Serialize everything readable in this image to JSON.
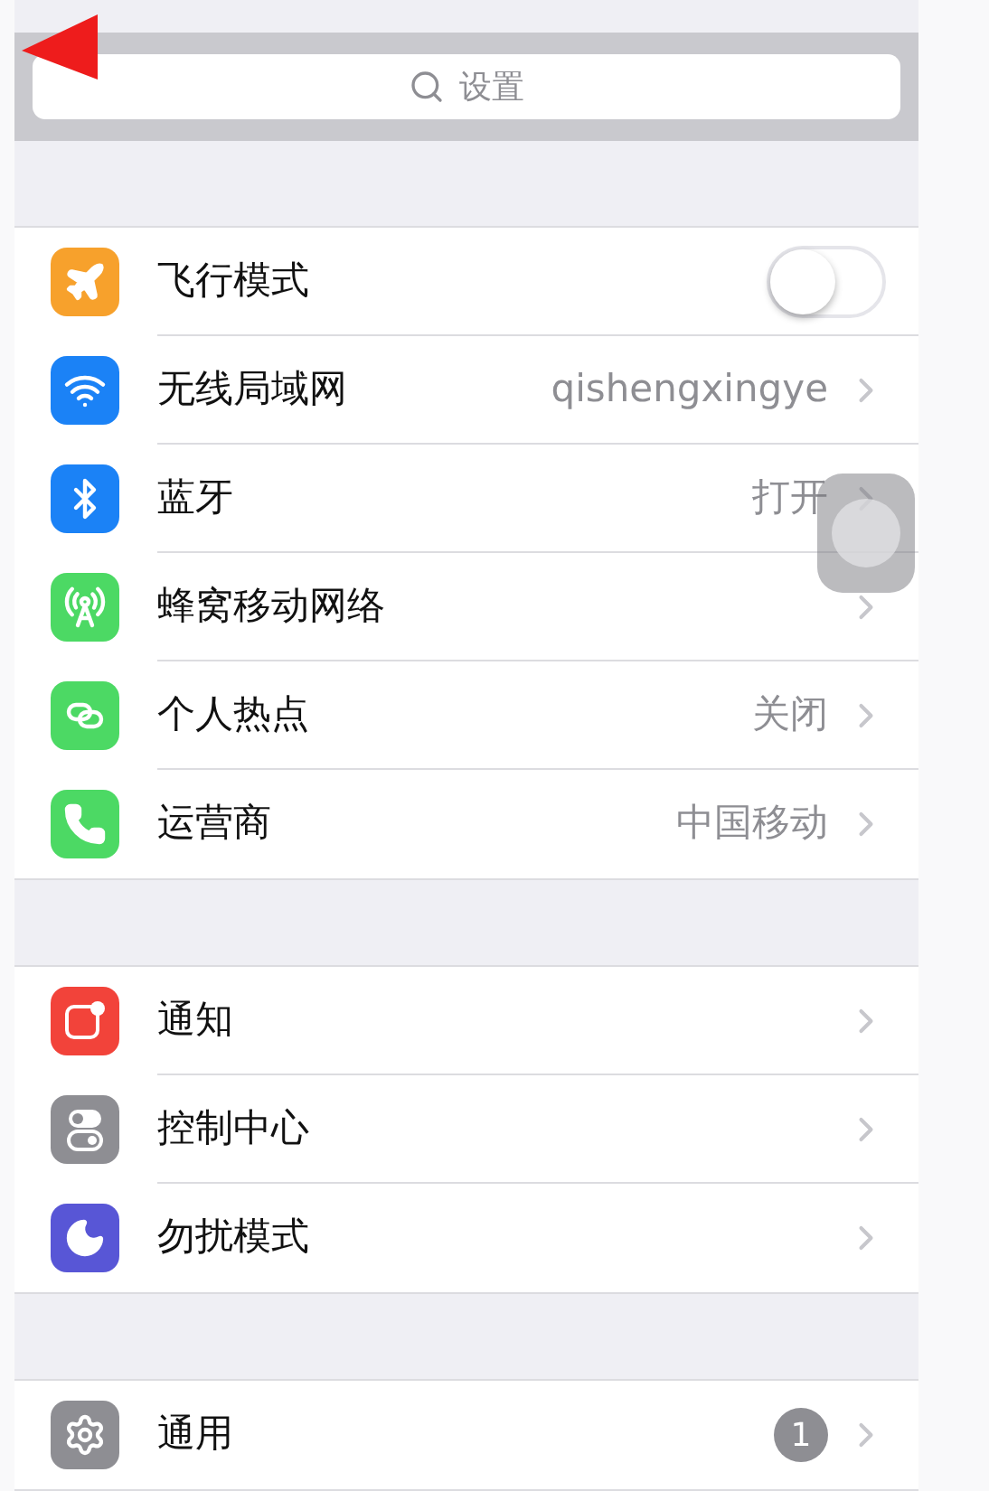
{
  "search": {
    "placeholder": "设置"
  },
  "groups": [
    {
      "rows": [
        {
          "kind": "toggle",
          "color": "#f7a12c",
          "label": "飞行模式",
          "on": false
        },
        {
          "kind": "link",
          "color": "#1b82f6",
          "label": "无线局域网",
          "value": "qishengxingye"
        },
        {
          "kind": "link",
          "color": "#1b82f6",
          "label": "蓝牙",
          "value": "打开"
        },
        {
          "kind": "link",
          "color": "#4cd964",
          "label": "蜂窝移动网络"
        },
        {
          "kind": "link",
          "color": "#4cd964",
          "label": "个人热点",
          "value": "关闭"
        },
        {
          "kind": "link",
          "color": "#4cd964",
          "label": "运营商",
          "value": "中国移动"
        }
      ]
    },
    {
      "rows": [
        {
          "kind": "link",
          "color": "#f2433a",
          "label": "通知"
        },
        {
          "kind": "link",
          "color": "#8e8e93",
          "label": "控制中心"
        },
        {
          "kind": "link",
          "color": "#5856d6",
          "label": "勿扰模式"
        }
      ]
    },
    {
      "rows": [
        {
          "kind": "link",
          "color": "#8e8e93",
          "label": "通用",
          "badge": "1"
        }
      ]
    }
  ]
}
